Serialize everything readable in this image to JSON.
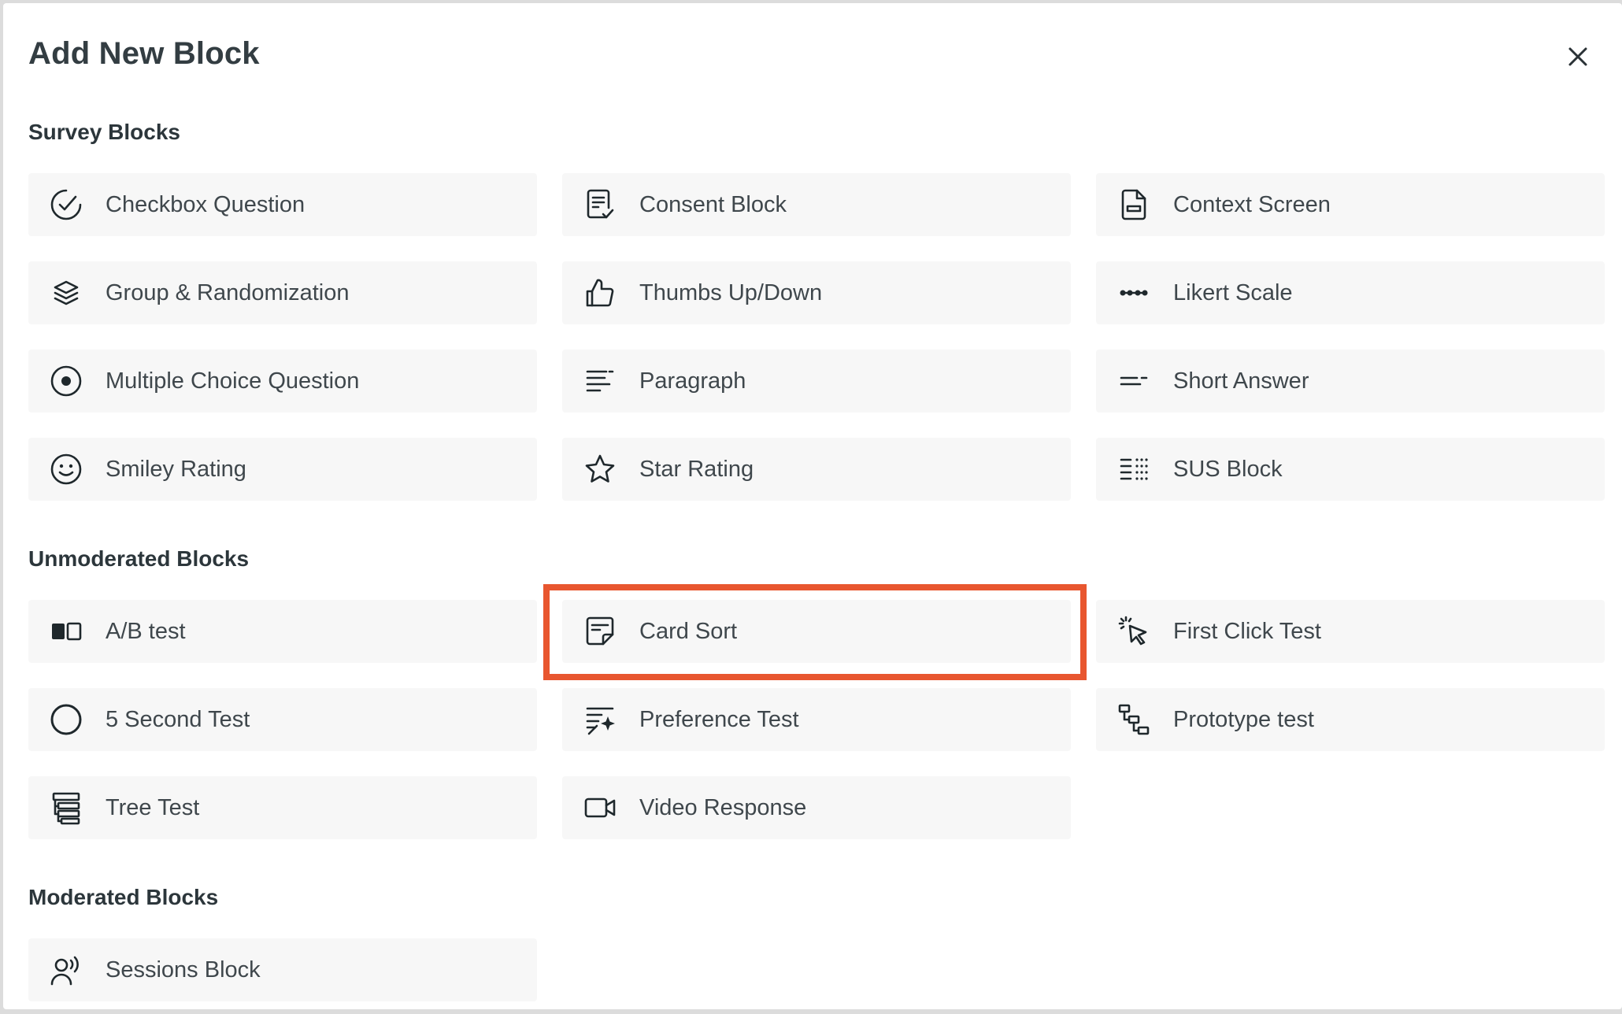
{
  "modal": {
    "title": "Add New Block",
    "close_icon": "close-icon"
  },
  "sections": {
    "survey": {
      "title": "Survey Blocks",
      "items": [
        {
          "label": "Checkbox Question",
          "icon": "check-circle-icon"
        },
        {
          "label": "Consent Block",
          "icon": "document-check-icon"
        },
        {
          "label": "Context Screen",
          "icon": "document-icon"
        },
        {
          "label": "Group & Randomization",
          "icon": "layers-icon"
        },
        {
          "label": "Thumbs Up/Down",
          "icon": "thumbs-up-icon"
        },
        {
          "label": "Likert Scale",
          "icon": "likert-dots-icon"
        },
        {
          "label": "Multiple Choice Question",
          "icon": "radio-icon"
        },
        {
          "label": "Paragraph",
          "icon": "paragraph-icon"
        },
        {
          "label": "Short Answer",
          "icon": "short-answer-icon"
        },
        {
          "label": "Smiley Rating",
          "icon": "smiley-icon"
        },
        {
          "label": "Star Rating",
          "icon": "star-icon"
        },
        {
          "label": "SUS Block",
          "icon": "sus-list-icon"
        }
      ]
    },
    "unmoderated": {
      "title": "Unmoderated Blocks",
      "items": [
        {
          "label": "A/B test",
          "icon": "ab-test-icon"
        },
        {
          "label": "Card Sort",
          "icon": "card-sort-icon"
        },
        {
          "label": "First Click Test",
          "icon": "cursor-click-icon"
        },
        {
          "label": "5 Second Test",
          "icon": "circle-icon"
        },
        {
          "label": "Preference Test",
          "icon": "preference-icon"
        },
        {
          "label": "Prototype test",
          "icon": "prototype-flow-icon"
        },
        {
          "label": "Tree Test",
          "icon": "tree-test-icon"
        },
        {
          "label": "Video Response",
          "icon": "video-camera-icon"
        }
      ]
    },
    "moderated": {
      "title": "Moderated Blocks",
      "items": [
        {
          "label": "Sessions Block",
          "icon": "user-voice-icon"
        }
      ]
    }
  },
  "colors": {
    "highlight": "#e8562f",
    "card_background": "#f7f7f7",
    "icon": "#1f282c"
  }
}
